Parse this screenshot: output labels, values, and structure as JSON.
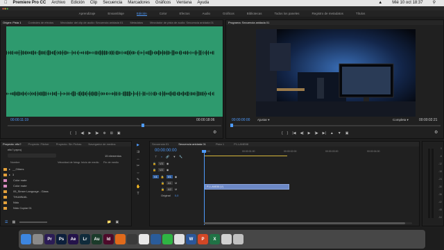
{
  "menubar": {
    "app": "Premiere Pro CC",
    "items": [
      "Archivo",
      "Edición",
      "Clip",
      "Secuencia",
      "Marcadores",
      "Gráficos",
      "Ventana",
      "Ayuda"
    ],
    "clock": "Mié 10 oct 18:37"
  },
  "workspaces": {
    "items": [
      "Aprendizaje",
      "Ensamblaje",
      "Edición",
      "Color",
      "Efectos",
      "Audio",
      "Gráficos",
      "Bibliotecas",
      "Todos los paneles",
      "Registro de metadatos",
      "Títulos"
    ],
    "active_index": 2
  },
  "source_monitor": {
    "tabs": [
      "Origen: Pista 1",
      "Controles de efectos",
      "Mezclador del clip de audio: Secuencia anidada 01",
      "Metadatos",
      "Mezclador de pista de audio: Secuencia anidada 01"
    ],
    "timecode_left": "00:00:11:19",
    "timecode_right": "00:00:18:06",
    "waveform_color": "#2e9a6e"
  },
  "program_monitor": {
    "tab": "Programa: Secuencia anidada 01",
    "timecode_left": "00:00:00:00",
    "timecode_right": "00:00:02:21",
    "fit": "Ajustar",
    "quality": "Completa"
  },
  "project": {
    "tabs": [
      "Proyecto: eltc?",
      "Proyecto: Fitcher",
      "Proyecto: Sin Fichas",
      "Navegador de medios"
    ],
    "file_name": "eltc?.prproj",
    "item_count": "15 elementos",
    "columns": [
      "Nombre",
      "Velocidad de fotogr.",
      "Inicio de medio",
      "Fin de medio"
    ],
    "rows": [
      {
        "name": "__Others",
        "color": "#e3a03a"
      },
      {
        "name": "3",
        "color": "#e3a03a"
      },
      {
        "name": "Color mate",
        "color": "#d98ac0"
      },
      {
        "name": "Color mate",
        "color": "#d98ac0"
      },
      {
        "name": "05_Sinser Language - Glass",
        "color": "#e3a03a"
      },
      {
        "name": "THUMNAIL",
        "color": "#e3a03a"
      },
      {
        "name": "Nido",
        "color": "#e3a03a"
      },
      {
        "name": "Nido Copiar 01",
        "color": "#e3a03a"
      }
    ]
  },
  "timeline": {
    "tabs": [
      "Secuencia 01",
      "Secuencia anidada 01",
      "Pista 1",
      "P1.LANE88"
    ],
    "timecode": "00:00:00:00",
    "ruler": [
      "00:00",
      "00:00:01:00",
      "00:00:02:00",
      "00:00:03:00",
      "00:00:04:00"
    ],
    "video_tracks": [
      "V3",
      "V2",
      "V1"
    ],
    "audio_tracks": [
      "A1",
      "A2"
    ],
    "master": "Original",
    "master_value": "0,0",
    "clip_label": "P1.LANE88 (V)",
    "clip_color": "#6c88c6"
  },
  "meter_scale": [
    "0",
    "-6",
    "-12",
    "-18",
    "-24",
    "-30",
    "-36",
    "-42",
    "-48",
    "-54"
  ],
  "dock": {
    "apps": [
      {
        "name": "finder",
        "label": "",
        "color": "#3d86e0"
      },
      {
        "name": "launchpad",
        "label": "",
        "color": "#8a8a8a"
      },
      {
        "name": "premiere",
        "label": "Pr",
        "color": "#2b1c55"
      },
      {
        "name": "photoshop",
        "label": "Ps",
        "color": "#0c1f3b"
      },
      {
        "name": "after-effects",
        "label": "Ae",
        "color": "#24134a"
      },
      {
        "name": "lightroom",
        "label": "Lr",
        "color": "#102b3b"
      },
      {
        "name": "audition",
        "label": "Au",
        "color": "#1b3b2a"
      },
      {
        "name": "indesign",
        "label": "Id",
        "color": "#4d0a2a"
      },
      {
        "name": "firefox",
        "label": "",
        "color": "#e06a1b"
      },
      {
        "name": "quicktime",
        "label": "",
        "color": "#3a3a3a"
      },
      {
        "name": "chrome",
        "label": "",
        "color": "#e8e8e8"
      },
      {
        "name": "xcode",
        "label": "",
        "color": "#2a5c9a"
      },
      {
        "name": "whatsapp",
        "label": "",
        "color": "#2fb543"
      },
      {
        "name": "music",
        "label": "",
        "color": "#e0e0e0"
      },
      {
        "name": "word",
        "label": "W",
        "color": "#2b579a"
      },
      {
        "name": "powerpoint",
        "label": "P",
        "color": "#d24726"
      },
      {
        "name": "excel",
        "label": "X",
        "color": "#207245"
      },
      {
        "name": "keyboard",
        "label": "",
        "color": "#d0d0d0"
      },
      {
        "name": "trash",
        "label": "",
        "color": "#c0c0c0"
      }
    ]
  }
}
